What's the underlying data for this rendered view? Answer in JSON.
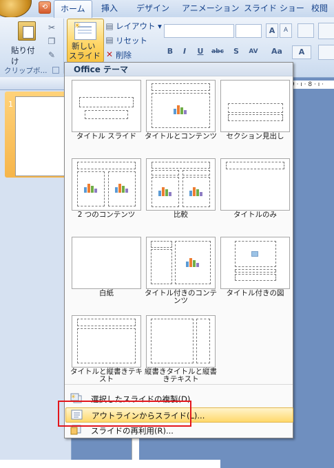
{
  "tabs": [
    "ホーム",
    "挿入",
    "デザイン",
    "アニメーション",
    "スライド ショー",
    "校閲"
  ],
  "ribbon": {
    "paste_label": "貼り付け",
    "clipboard_group": "クリップボ...",
    "new_slide_line1": "新しい",
    "new_slide_line2": "スライド ▾",
    "layout_label": "レイアウト ▾",
    "reset_label": "リセット",
    "delete_label": "削除",
    "font_size_a": "A",
    "fmt_buttons": [
      "B",
      "I",
      "U",
      "abc",
      "S",
      "AV",
      "Aa",
      "A"
    ]
  },
  "left_pane": {
    "slide_number": "1"
  },
  "ruler_text": "9 · ı · 8 · ı ·",
  "gallery": {
    "header": "Office テーマ",
    "layouts": [
      {
        "name": "タイトル スライド"
      },
      {
        "name": "タイトルとコンテンツ"
      },
      {
        "name": "セクション見出し"
      },
      {
        "name": "2 つのコンテンツ"
      },
      {
        "name": "比較"
      },
      {
        "name": "タイトルのみ"
      },
      {
        "name": "白紙"
      },
      {
        "name": "タイトル付きのコンテンツ"
      },
      {
        "name": "タイトル付きの図"
      },
      {
        "name": "タイトルと縦書きテキスト"
      },
      {
        "name": "縦書きタイトルと縦書きテキスト"
      }
    ],
    "menu": [
      {
        "label": "選択したスライドの複製(D)"
      },
      {
        "label": "アウトラインからスライド(L)..."
      },
      {
        "label": "スライドの再利用(R)..."
      }
    ]
  },
  "colors": {
    "highlight": "#ffd86b",
    "annotation": "#e3151b",
    "accent": "#15428b"
  }
}
